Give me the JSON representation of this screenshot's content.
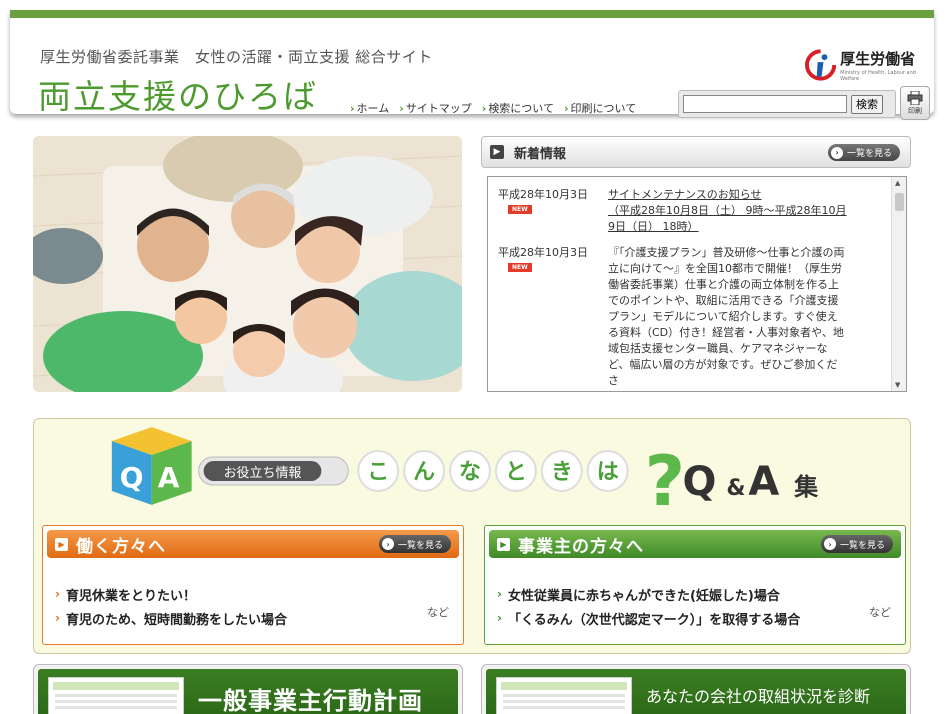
{
  "header": {
    "subtitle": "厚生労働省委託事業　女性の活躍・両立支援 総合サイト",
    "site_title": "両立支援のひろば",
    "nav": [
      "ホーム",
      "サイトマップ",
      "検索について",
      "印刷について"
    ],
    "ministry_name": "厚生労働省",
    "ministry_en": "Ministry of Health, Labour and Welfare",
    "search_placeholder": "",
    "search_button": "検索",
    "print_label": "印刷"
  },
  "news": {
    "title": "新着情報",
    "all_label": "一覧を見る",
    "badge": "NEW",
    "items": [
      {
        "date": "平成28年10月3日",
        "link": "サイトメンテナンスのお知らせ",
        "text": "（平成28年10月8日（土） 9時～平成28年10月9日（日） 18時）"
      },
      {
        "date": "平成28年10月3日",
        "text": "『「介護支援プラン」普及研修～仕事と介護の両立に向けて～』を全国10都市で開催！（厚生労働省委託事業）仕事と介護の両立体制を作る上でのポイントや、取組に活用できる「介護支援プラン」モデルについて紹介します。すぐ使える資料（CD）付き！経営者・人事対象者や、地域包括支援センター職員、ケアマネジャーなど、幅広い層の方が対象です。ぜひご参加くださ"
      }
    ]
  },
  "qa": {
    "badge": "お役立ち情報",
    "chars": [
      "こ",
      "ん",
      "な",
      "と",
      "き",
      "は"
    ],
    "question_mark": "?",
    "title_q": "Q",
    "title_amp": "&",
    "title_a": "A",
    "title_shu": "集",
    "box_q": "Q",
    "box_a": "A",
    "panels": [
      {
        "title": "働く方々へ",
        "all_label": "一覧を見る",
        "links": [
          "育児休業をとりたい！",
          "育児のため、短時間勤務をしたい場合"
        ],
        "more": "など"
      },
      {
        "title": "事業主の方々へ",
        "all_label": "一覧を見る",
        "links": [
          "女性従業員に赤ちゃんができた(妊娠した)場合",
          "「くるみん（次世代認定マーク）」を取得する場合"
        ],
        "more": "など"
      }
    ]
  },
  "bottom": {
    "left_title": "一般事業主行動計画",
    "right_title": "あなたの会社の取組状況を診断"
  },
  "colors": {
    "brand_green": "#4d9a2e",
    "header_bar": "#6c9f40",
    "orange": "#e06a12",
    "green": "#3f8a28",
    "new_badge": "#e23b2a"
  }
}
